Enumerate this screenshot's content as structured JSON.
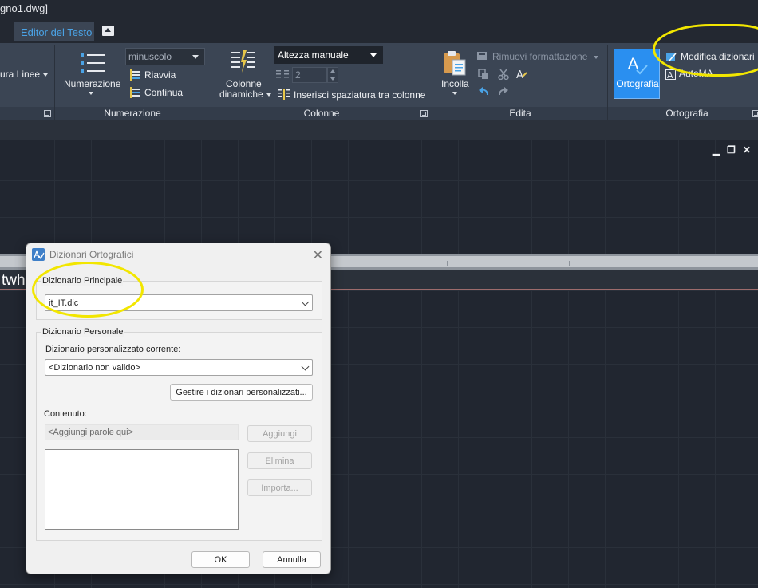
{
  "window": {
    "title": "gno1.dwg]"
  },
  "tabs": {
    "active": "Editor del Testo"
  },
  "ribbon": {
    "linee_label": "ura Linee",
    "numerazione": {
      "button_label": "Numerazione",
      "case_value": "minuscolo",
      "riavvia": "Riavvia",
      "continua": "Continua",
      "panel_label": "Numerazione"
    },
    "colonne": {
      "button_label_1": "Colonne",
      "button_label_2": "dinamiche",
      "height_mode": "Altezza manuale",
      "count_value": "2",
      "inserisci": "Inserisci spaziatura tra colonne",
      "panel_label": "Colonne"
    },
    "edita": {
      "incolla": "Incolla",
      "rimuovi": "Rimuovi formattazione",
      "panel_label": "Edita"
    },
    "ortografia": {
      "button_label": "Ortografia",
      "modifica": "Modifica dizionari",
      "automa": "AutoMA",
      "panel_label": "Ortografia"
    }
  },
  "editor": {
    "text": "twh"
  },
  "dialog": {
    "title": "Dizionari Ortografici",
    "principale": {
      "legend": "Dizionario Principale",
      "value": "it_IT.dic"
    },
    "personale": {
      "legend": "Dizionario Personale",
      "current_label": "Dizionario personalizzato corrente:",
      "current_value": "<Dizionario non valido>",
      "manage_button": "Gestire i dizionari personalizzati...",
      "content_label": "Contenuto:",
      "content_placeholder": "<Aggiungi parole qui>",
      "add_button": "Aggiungi",
      "delete_button": "Elimina",
      "import_button": "Importa..."
    },
    "ok_button": "OK",
    "cancel_button": "Annulla"
  },
  "colors": {
    "accent": "#2a8ff0",
    "highlight": "#f2e600",
    "ribbon": "#3b4554",
    "drawing_bg": "#212630"
  }
}
